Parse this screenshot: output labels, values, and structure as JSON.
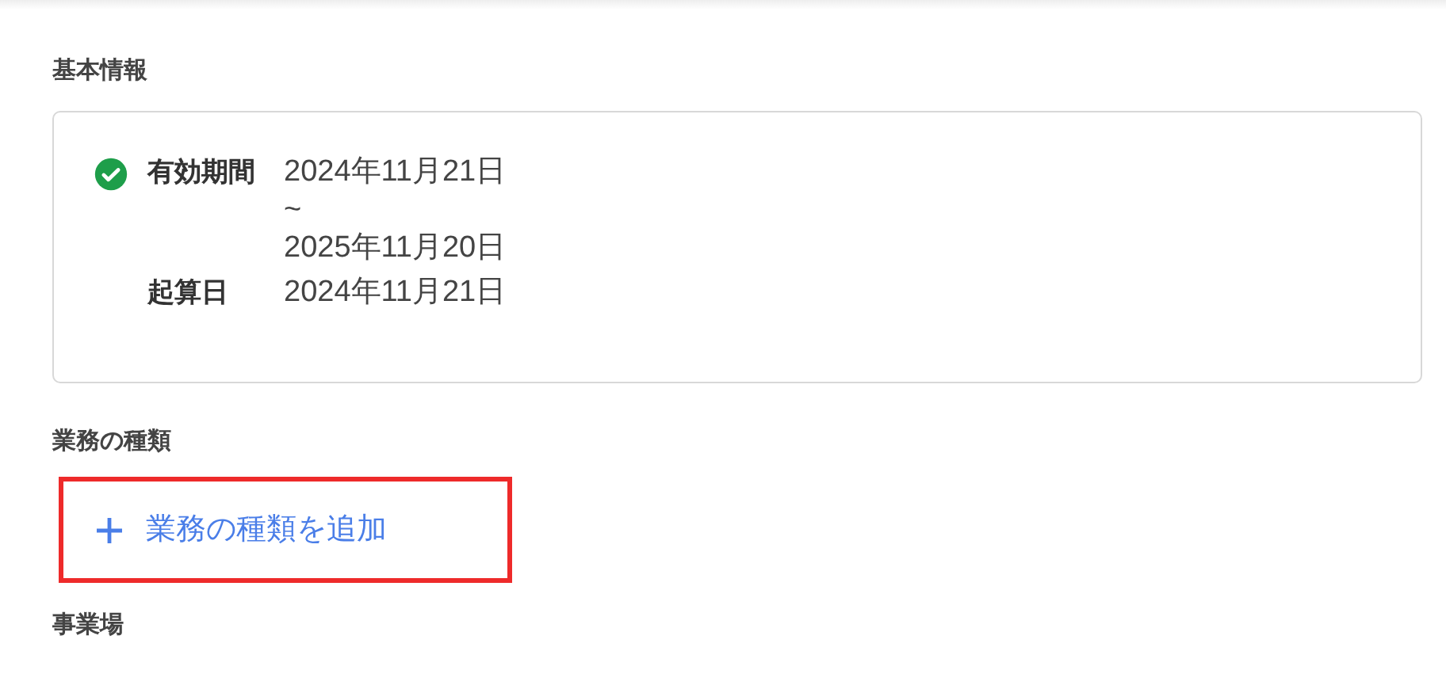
{
  "basic_info": {
    "title": "基本情報",
    "valid": true,
    "rows": [
      {
        "label": "有効期間",
        "lines": [
          "2024年11月21日",
          "~",
          "2025年11月20日"
        ]
      },
      {
        "label": "起算日",
        "lines": [
          "2024年11月21日"
        ]
      }
    ]
  },
  "business_types": {
    "title": "業務の種類",
    "add_button": {
      "label": "業務の種類を追加",
      "highlighted": true
    }
  },
  "workplace": {
    "title": "事業場"
  }
}
